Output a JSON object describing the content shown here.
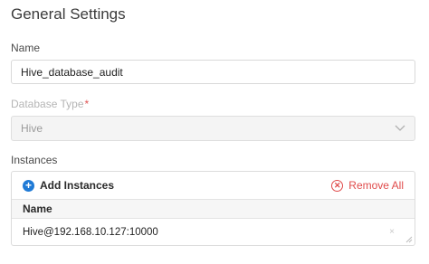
{
  "section": {
    "title": "General Settings"
  },
  "name_field": {
    "label": "Name",
    "value": "Hive_database_audit"
  },
  "db_type": {
    "label": "Database Type",
    "required_mark": "*",
    "value": "Hive"
  },
  "instances": {
    "label": "Instances",
    "add_label": "Add Instances",
    "remove_label": "Remove All",
    "column_header": "Name",
    "rows": [
      {
        "name": "Hive@192.168.10.127:10000",
        "remove_glyph": "×"
      }
    ]
  },
  "icons": {
    "add": "plus-circle-icon",
    "remove": "x-circle-icon",
    "select": "chevron-down-icon"
  },
  "colors": {
    "accent": "#1f7ad6",
    "danger": "#e04b4b",
    "required": "#e05353"
  }
}
